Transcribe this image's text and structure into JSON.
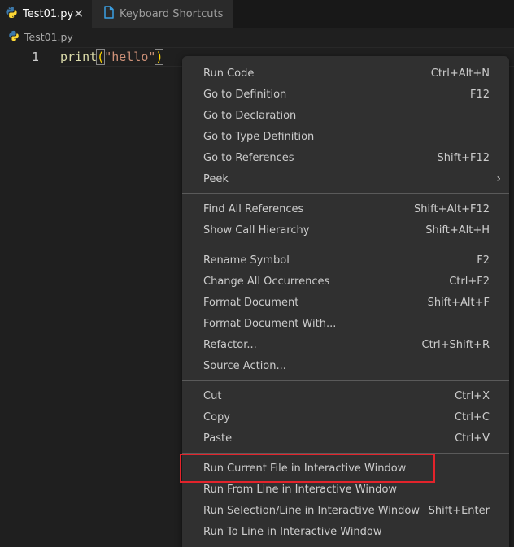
{
  "tabs": [
    {
      "label": "Test01.py",
      "icon": "python-icon",
      "active": true,
      "close_glyph": "✕"
    },
    {
      "label": "Keyboard Shortcuts",
      "icon": "file-icon",
      "active": false
    }
  ],
  "breadcrumb": {
    "label": "Test01.py",
    "icon": "python-icon"
  },
  "editor": {
    "lines": [
      {
        "number": "1",
        "tokens": {
          "fn": "print",
          "open": "(",
          "str": "\"hello\"",
          "close": ")"
        }
      }
    ]
  },
  "context_menu": {
    "groups": [
      [
        {
          "label": "Run Code",
          "shortcut": "Ctrl+Alt+N"
        },
        {
          "label": "Go to Definition",
          "shortcut": "F12"
        },
        {
          "label": "Go to Declaration",
          "shortcut": ""
        },
        {
          "label": "Go to Type Definition",
          "shortcut": ""
        },
        {
          "label": "Go to References",
          "shortcut": "Shift+F12"
        },
        {
          "label": "Peek",
          "shortcut": "",
          "submenu": true
        }
      ],
      [
        {
          "label": "Find All References",
          "shortcut": "Shift+Alt+F12"
        },
        {
          "label": "Show Call Hierarchy",
          "shortcut": "Shift+Alt+H"
        }
      ],
      [
        {
          "label": "Rename Symbol",
          "shortcut": "F2"
        },
        {
          "label": "Change All Occurrences",
          "shortcut": "Ctrl+F2"
        },
        {
          "label": "Format Document",
          "shortcut": "Shift+Alt+F"
        },
        {
          "label": "Format Document With...",
          "shortcut": ""
        },
        {
          "label": "Refactor...",
          "shortcut": "Ctrl+Shift+R"
        },
        {
          "label": "Source Action...",
          "shortcut": ""
        }
      ],
      [
        {
          "label": "Cut",
          "shortcut": "Ctrl+X"
        },
        {
          "label": "Copy",
          "shortcut": "Ctrl+C"
        },
        {
          "label": "Paste",
          "shortcut": "Ctrl+V"
        }
      ],
      [
        {
          "label": "Run Current File in Interactive Window",
          "shortcut": "",
          "highlighted": true
        },
        {
          "label": "Run From Line in Interactive Window",
          "shortcut": ""
        },
        {
          "label": "Run Selection/Line in Interactive Window",
          "shortcut": "Shift+Enter"
        },
        {
          "label": "Run To Line in Interactive Window",
          "shortcut": ""
        }
      ]
    ],
    "submenu_arrow": "›"
  },
  "colors": {
    "highlight_box": "#e3232b",
    "menu_bg": "#303030",
    "editor_bg": "#1f1f1f"
  }
}
